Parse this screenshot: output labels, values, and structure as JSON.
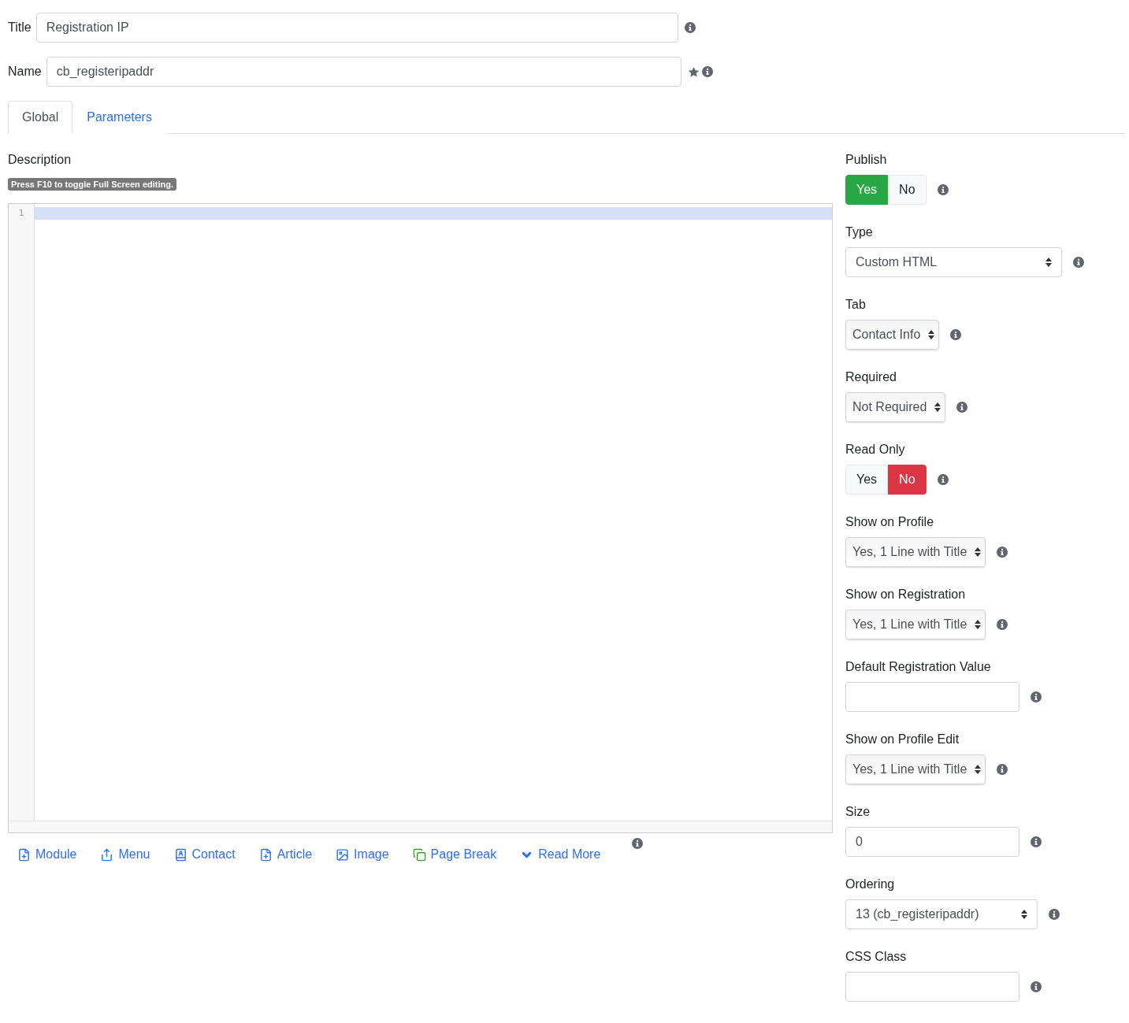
{
  "header_fields": [
    {
      "label": "Title",
      "value": "Registration IP",
      "starred": false
    },
    {
      "label": "Name",
      "value": "cb_registeripaddr",
      "starred": true
    }
  ],
  "tabs": [
    {
      "label": "Global",
      "selected": true
    },
    {
      "label": "Parameters",
      "selected": false
    }
  ],
  "description": {
    "label": "Description",
    "hint": "Press F10 to toggle Full Screen editing.",
    "editor": {
      "line_numbers": [
        "1"
      ],
      "active_line": true
    }
  },
  "editor_buttons": [
    {
      "label": "Module",
      "kind": "module"
    },
    {
      "label": "Menu",
      "kind": "menu"
    },
    {
      "label": "Contact",
      "kind": "contact"
    },
    {
      "label": "Article",
      "kind": "article"
    },
    {
      "label": "Image",
      "kind": "image"
    },
    {
      "label": "Page Break",
      "kind": "pagebreak"
    },
    {
      "label": "Read More",
      "kind": "readmore"
    }
  ],
  "fields": [
    {
      "label": "Publish",
      "kind": "toggle",
      "options": [
        {
          "label": "Yes",
          "selected": true
        },
        {
          "label": "No",
          "selected": false
        }
      ]
    },
    {
      "label": "Type",
      "kind": "select",
      "value": "Custom HTML"
    },
    {
      "label": "Tab",
      "kind": "listbox",
      "value": "Contact Info"
    },
    {
      "label": "Required",
      "kind": "listbox",
      "value": "Not Required"
    },
    {
      "label": "Read Only",
      "kind": "toggle",
      "options": [
        {
          "label": "Yes",
          "selected": false
        },
        {
          "label": "No",
          "selected": true
        }
      ]
    },
    {
      "label": "Show on Profile",
      "kind": "listbox",
      "value": "Yes, 1 Line with Title"
    },
    {
      "label": "Show on Registration",
      "kind": "listbox",
      "value": "Yes, 1 Line with Title"
    },
    {
      "label": "Default Registration Value",
      "kind": "text"
    },
    {
      "label": "Show on Profile Edit",
      "kind": "listbox",
      "value": "Yes, 1 Line with Title"
    },
    {
      "label": "Size",
      "kind": "text",
      "value": "0"
    },
    {
      "label": "Ordering",
      "kind": "select",
      "value": "13 (cb_registeripaddr)"
    },
    {
      "label": "CSS Class",
      "kind": "text"
    }
  ]
}
